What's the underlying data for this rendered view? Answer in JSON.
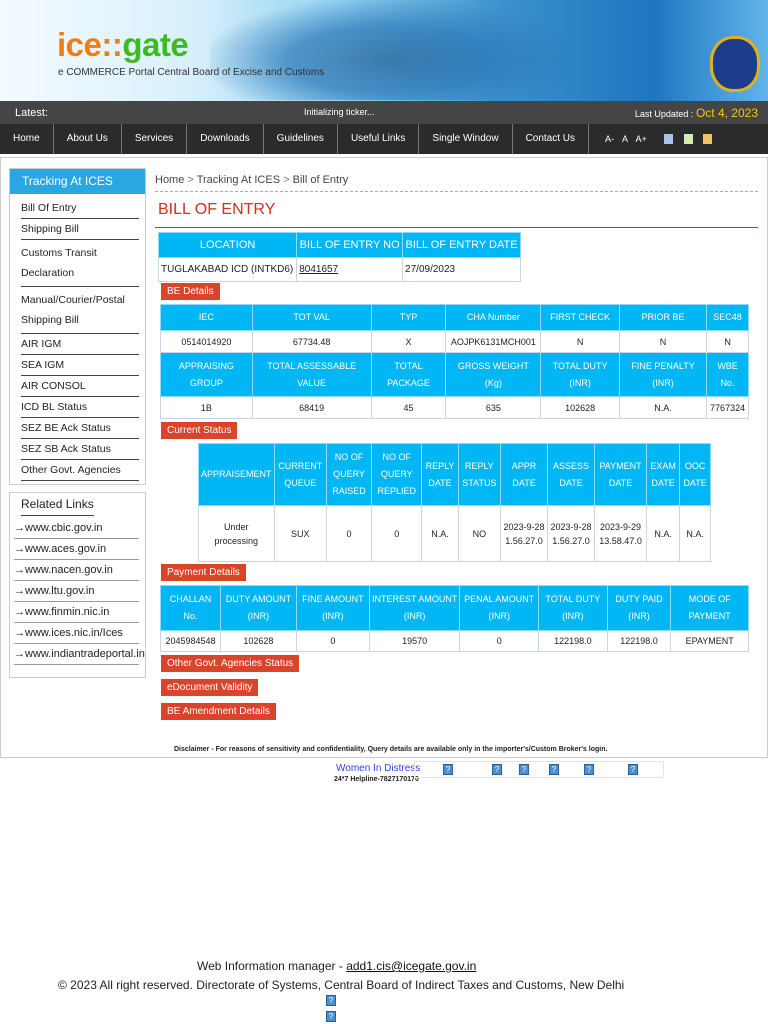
{
  "header": {
    "logo_ice": "ice",
    "logo_sep": "::",
    "logo_gate": "gate",
    "tagline": "e COMMERCE Portal Central Board of Excise and Customs"
  },
  "ticker": {
    "latest": "Latest:",
    "message": "Initializing ticker...",
    "updated_label": "Last Updated :",
    "updated_date": "Oct 4, 2023"
  },
  "nav": {
    "items": [
      "Home",
      "About Us",
      "Services",
      "Downloads",
      "Guidelines",
      "Useful Links",
      "Single Window",
      "Contact Us"
    ],
    "font_sizes": "A- A A+"
  },
  "sidebar": {
    "title": "Tracking At ICES",
    "items": [
      "Bill Of Entry",
      "Shipping Bill",
      "Customs Transit Declaration",
      "Manual/Courier/Postal Shipping Bill",
      "AIR IGM",
      "SEA IGM",
      "AIR CONSOL",
      "ICD BL Status",
      "SEZ BE Ack Status",
      "SEZ SB Ack Status",
      "Other Govt. Agencies"
    ],
    "related_title": "Related Links",
    "links": [
      "www.cbic.gov.in",
      "www.aces.gov.in",
      "www.nacen.gov.in",
      "www.ltu.gov.in",
      "www.finmin.nic.in",
      "www.ices.nic.in/Ices",
      "www.indiantradeportal.in"
    ]
  },
  "breadcrumb": {
    "home": "Home",
    "sep": ">",
    "tracking": "Tracking At ICES",
    "current": "Bill of Entry"
  },
  "page_title": "BILL OF ENTRY",
  "location_table": {
    "headers": [
      "LOCATION",
      "BILL OF ENTRY NO",
      "BILL OF ENTRY DATE"
    ],
    "row": [
      "TUGLAKABAD ICD (INTKD6)",
      "8041657",
      "27/09/2023"
    ]
  },
  "be_details": {
    "label": "BE Details",
    "headers1": [
      "IEC",
      "TOT VAL",
      "TYP",
      "CHA Number",
      "FIRST CHECK",
      "PRIOR BE",
      "SEC48"
    ],
    "row1": [
      "0514014920",
      "67734.48",
      "X",
      "AOJPK6131MCH001",
      "N",
      "N",
      "N"
    ],
    "headers2": [
      "APPRAISING GROUP",
      "TOTAL ASSESSABLE VALUE",
      "TOTAL PACKAGE",
      "GROSS WEIGHT (Kg)",
      "TOTAL DUTY (INR)",
      "FINE PENALTY (INR)",
      "WBE No."
    ],
    "row2": [
      "1B",
      "68419",
      "45",
      "635",
      "102628",
      "N.A.",
      "7767324"
    ]
  },
  "current_status": {
    "label": "Current Status",
    "headers": [
      "APPRAISEMENT",
      "CURRENT QUEUE",
      "NO OF QUERY RAISED",
      "NO OF QUERY REPLIED",
      "REPLY DATE",
      "REPLY STATUS",
      "APPR DATE",
      "ASSESS DATE",
      "PAYMENT DATE",
      "EXAM DATE",
      "OOC DATE"
    ],
    "row": [
      "Under processing",
      "SUX",
      "0",
      "0",
      "N.A.",
      "NO",
      "2023-9-28 1.56.27.0",
      "2023-9-28 1.56.27.0",
      "2023-9-29 13.58.47.0",
      "N.A.",
      "N.A."
    ]
  },
  "payment": {
    "label": "Payment Details",
    "headers": [
      "CHALLAN No.",
      "DUTY AMOUNT (INR)",
      "FINE AMOUNT (INR)",
      "INTEREST AMOUNT (INR)",
      "PENAL AMOUNT (INR)",
      "TOTAL DUTY (INR)",
      "DUTY PAID (INR)",
      "MODE OF PAYMENT"
    ],
    "row": [
      "2045984548",
      "102628",
      "0",
      "19570",
      "0",
      "122198.0",
      "122198.0",
      "EPAYMENT"
    ]
  },
  "buttons": {
    "oga": "Other Govt. Agencies Status",
    "edoc": "eDocument Validity",
    "amend": "BE Amendment Details"
  },
  "disclaimer": "Disclaimer - For reasons of sensitivity and confidentiality, Query details are available only in the importer's/Custom Broker's login.",
  "women": {
    "label": "Women In Distress",
    "helpline": "24*7 Helpline-7827170170"
  },
  "footer": {
    "wim_label": "Web Information manager -",
    "wim_email": "add1.cis@icegate.gov.in",
    "copyright": "© 2023 All right reserved. Directorate of Systems, Central Board of Indirect Taxes and Customs, New Delhi"
  },
  "colors": {
    "blue": "#00b6f4",
    "red": "#d9442a",
    "nav": "#2b2b2b"
  }
}
